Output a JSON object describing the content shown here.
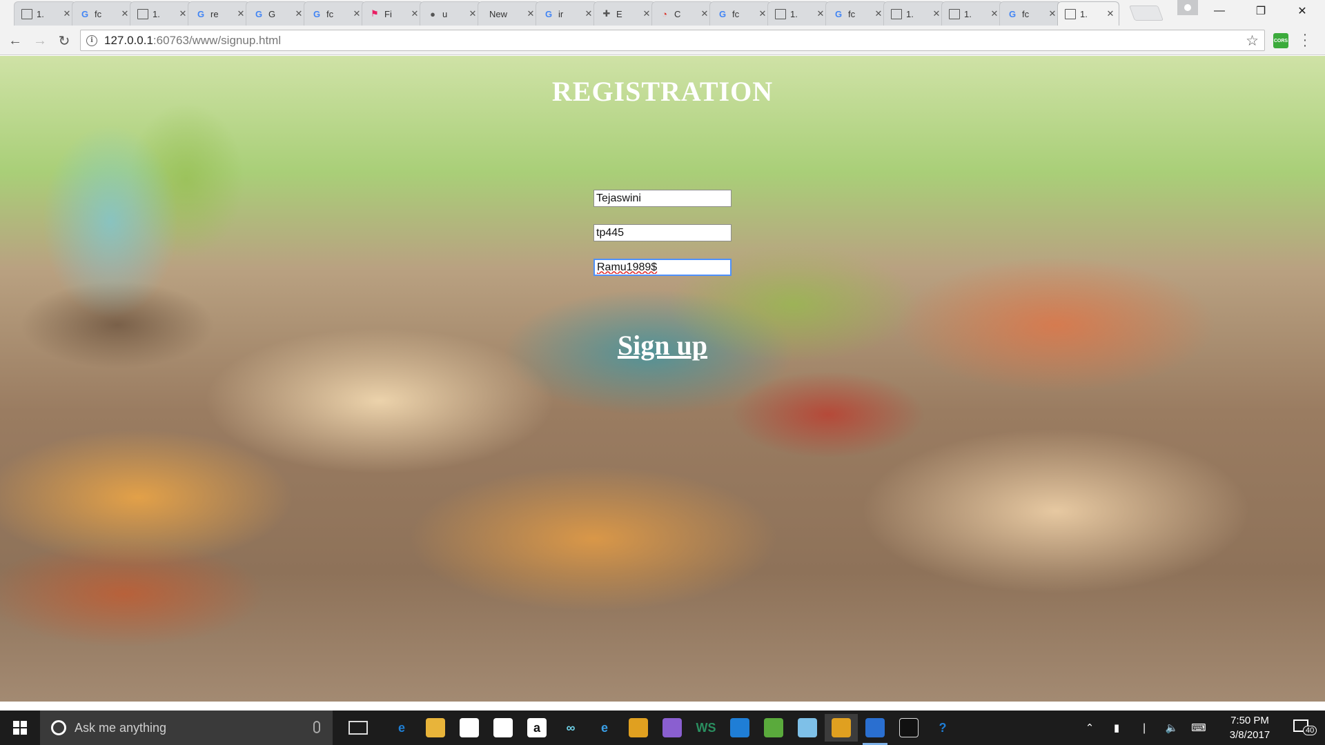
{
  "browser": {
    "tabs": [
      {
        "label": "1.",
        "icon": "doc-icon"
      },
      {
        "label": "fc",
        "icon": "google-icon"
      },
      {
        "label": "1.",
        "icon": "doc-icon"
      },
      {
        "label": "re",
        "icon": "google-icon"
      },
      {
        "label": "G",
        "icon": "google-icon"
      },
      {
        "label": "fc",
        "icon": "google-icon"
      },
      {
        "label": "Fi",
        "icon": "flag-icon"
      },
      {
        "label": "u",
        "icon": "github-icon"
      },
      {
        "label": "New",
        "icon": ""
      },
      {
        "label": "ir",
        "icon": "google-icon"
      },
      {
        "label": "E",
        "icon": "puzzle-icon"
      },
      {
        "label": "C",
        "icon": "chrome-icon"
      },
      {
        "label": "fc",
        "icon": "google-icon"
      },
      {
        "label": "1.",
        "icon": "doc-icon"
      },
      {
        "label": "fc",
        "icon": "google-icon"
      },
      {
        "label": "1.",
        "icon": "doc-icon"
      },
      {
        "label": "1.",
        "icon": "doc-icon"
      },
      {
        "label": "fc",
        "icon": "google-icon"
      },
      {
        "label": "1.",
        "icon": "doc-icon",
        "active": true
      }
    ],
    "url_host": "127.0.0.1",
    "url_rest": ":60763/www/signup.html",
    "extension_label": "CORS"
  },
  "page": {
    "title": "REGISTRATION",
    "fields": {
      "name_value": "Tejaswini",
      "username_value": "tp445",
      "password_value": "Ramu1989$"
    },
    "signup_label": "Sign up"
  },
  "taskbar": {
    "search_placeholder": "Ask me anything",
    "time": "7:50 PM",
    "date": "3/8/2017",
    "notification_count": "40",
    "apps": [
      {
        "name": "edge-icon",
        "glyph": "e",
        "color": "#1e7fd6"
      },
      {
        "name": "file-explorer-icon",
        "glyph": "",
        "color": "#e8b43a"
      },
      {
        "name": "store-icon",
        "glyph": "",
        "color": "#ffffff"
      },
      {
        "name": "dropbox-icon",
        "glyph": "",
        "color": "#ffffff"
      },
      {
        "name": "amazon-icon",
        "glyph": "a",
        "color": "#ffffff"
      },
      {
        "name": "infinity-icon",
        "glyph": "∞",
        "color": "#6fd2e8"
      },
      {
        "name": "internet-explorer-icon",
        "glyph": "e",
        "color": "#3aa0e8"
      },
      {
        "name": "chrome-icon",
        "glyph": "",
        "color": "#e0a020"
      },
      {
        "name": "github-desktop-icon",
        "glyph": "",
        "color": "#8a5fd0"
      },
      {
        "name": "webstorm-icon",
        "glyph": "WS",
        "color": "#2a8f60"
      },
      {
        "name": "visual-studio-code-icon",
        "glyph": "",
        "color": "#1f7ed6"
      },
      {
        "name": "android-studio-icon",
        "glyph": "",
        "color": "#5aaa3c"
      },
      {
        "name": "notepad-icon",
        "glyph": "",
        "color": "#7ec0e8"
      },
      {
        "name": "chrome-active-icon",
        "glyph": "",
        "color": "#e0a020",
        "active": true
      },
      {
        "name": "app-active-icon",
        "glyph": "",
        "color": "#2a6fd0",
        "running": true
      },
      {
        "name": "terminal-icon",
        "glyph": "",
        "color": "#111111"
      },
      {
        "name": "help-icon",
        "glyph": "?",
        "color": "#1f7ed6"
      }
    ]
  }
}
